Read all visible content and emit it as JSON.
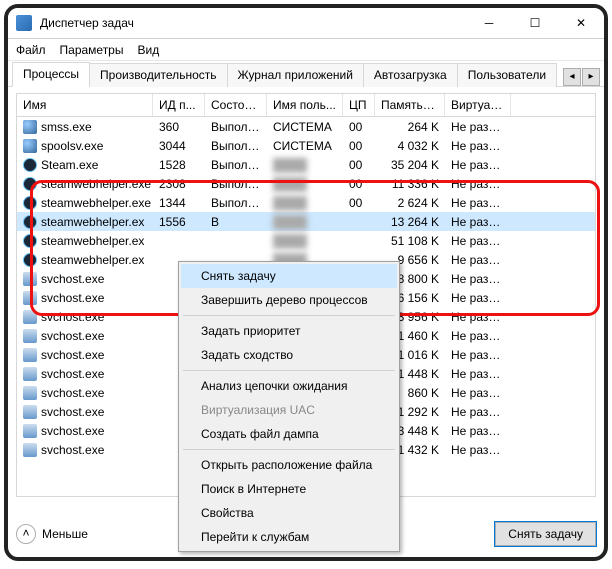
{
  "window": {
    "title": "Диспетчер задач"
  },
  "menu": {
    "file": "Файл",
    "options": "Параметры",
    "view": "Вид"
  },
  "tabs": {
    "processes": "Процессы",
    "performance": "Производительность",
    "apphistory": "Журнал приложений",
    "startup": "Автозагрузка",
    "users": "Пользователи"
  },
  "cols": {
    "name": "Имя",
    "pid": "ИД п...",
    "state": "Состоя...",
    "user": "Имя поль...",
    "cpu": "ЦП",
    "mem": "Память (а...",
    "virt": "Виртуал..."
  },
  "rows": [
    {
      "ico": "sys",
      "name": "smss.exe",
      "pid": "360",
      "state": "Выполн...",
      "user": "СИСТЕМА",
      "cpu": "00",
      "mem": "264 K",
      "virt": "Не разр..."
    },
    {
      "ico": "sys",
      "name": "spoolsv.exe",
      "pid": "3044",
      "state": "Выполн...",
      "user": "СИСТЕМА",
      "cpu": "00",
      "mem": "4 032 K",
      "virt": "Не разр..."
    },
    {
      "ico": "steam",
      "name": "Steam.exe",
      "pid": "1528",
      "state": "Выполн...",
      "user": "",
      "cpu": "00",
      "mem": "35 204 K",
      "virt": "Не разр..."
    },
    {
      "ico": "steam",
      "name": "steamwebhelper.exe",
      "pid": "2308",
      "state": "Выполн...",
      "user": "",
      "cpu": "00",
      "mem": "11 336 K",
      "virt": "Не разр..."
    },
    {
      "ico": "steam",
      "name": "steamwebhelper.exe",
      "pid": "1344",
      "state": "Выполн...",
      "user": "",
      "cpu": "00",
      "mem": "2 624 K",
      "virt": "Не разр..."
    },
    {
      "ico": "steam",
      "name": "steamwebhelper.ex",
      "pid": "1556",
      "state": "В",
      "user": "",
      "cpu": "",
      "mem": "13 264 K",
      "virt": "Не разр...",
      "sel": true
    },
    {
      "ico": "steam",
      "name": "steamwebhelper.ex",
      "pid": "",
      "state": "",
      "user": "",
      "cpu": "",
      "mem": "51 108 K",
      "virt": "Не разр..."
    },
    {
      "ico": "steam",
      "name": "steamwebhelper.ex",
      "pid": "",
      "state": "",
      "user": "",
      "cpu": "",
      "mem": "9 656 K",
      "virt": "Не разр..."
    },
    {
      "ico": "svc",
      "name": "svchost.exe",
      "pid": "",
      "state": "",
      "user": "",
      "cpu": "",
      "mem": "48 800 K",
      "virt": "Не разр..."
    },
    {
      "ico": "svc",
      "name": "svchost.exe",
      "pid": "",
      "state": "",
      "user": "",
      "cpu": "",
      "mem": "6 156 K",
      "virt": "Не разр..."
    },
    {
      "ico": "svc",
      "name": "svchost.exe",
      "pid": "",
      "state": "",
      "user": "",
      "cpu": "",
      "mem": "3 956 K",
      "virt": "Не разр..."
    },
    {
      "ico": "svc",
      "name": "svchost.exe",
      "pid": "",
      "state": "",
      "user": "",
      "cpu": "",
      "mem": "1 460 K",
      "virt": "Не разр..."
    },
    {
      "ico": "svc",
      "name": "svchost.exe",
      "pid": "",
      "state": "",
      "user": "",
      "cpu": "",
      "mem": "1 016 K",
      "virt": "Не разр..."
    },
    {
      "ico": "svc",
      "name": "svchost.exe",
      "pid": "",
      "state": "",
      "user": "",
      "cpu": "",
      "mem": "1 448 K",
      "virt": "Не разр..."
    },
    {
      "ico": "svc",
      "name": "svchost.exe",
      "pid": "",
      "state": "",
      "user": "",
      "cpu": "",
      "mem": "860 K",
      "virt": "Не разр..."
    },
    {
      "ico": "svc",
      "name": "svchost.exe",
      "pid": "",
      "state": "",
      "user": "",
      "cpu": "",
      "mem": "1 292 K",
      "virt": "Не разр..."
    },
    {
      "ico": "svc",
      "name": "svchost.exe",
      "pid": "",
      "state": "",
      "user": "",
      "cpu": "",
      "mem": "3 448 K",
      "virt": "Не разр..."
    },
    {
      "ico": "svc",
      "name": "svchost.exe",
      "pid": "",
      "state": "",
      "user": "",
      "cpu": "",
      "mem": "1 432 K",
      "virt": "Не разр..."
    }
  ],
  "ctx": {
    "endtask": "Снять задачу",
    "endtree": "Завершить дерево процессов",
    "priority": "Задать приоритет",
    "affinity": "Задать сходство",
    "waitchain": "Анализ цепочки ожидания",
    "uac": "Виртуализация UAC",
    "dump": "Создать файл дампа",
    "openloc": "Открыть расположение файла",
    "search": "Поиск в Интернете",
    "props": "Свойства",
    "goservice": "Перейти к службам"
  },
  "footer": {
    "fewer": "Меньше",
    "endtask": "Снять задачу"
  }
}
